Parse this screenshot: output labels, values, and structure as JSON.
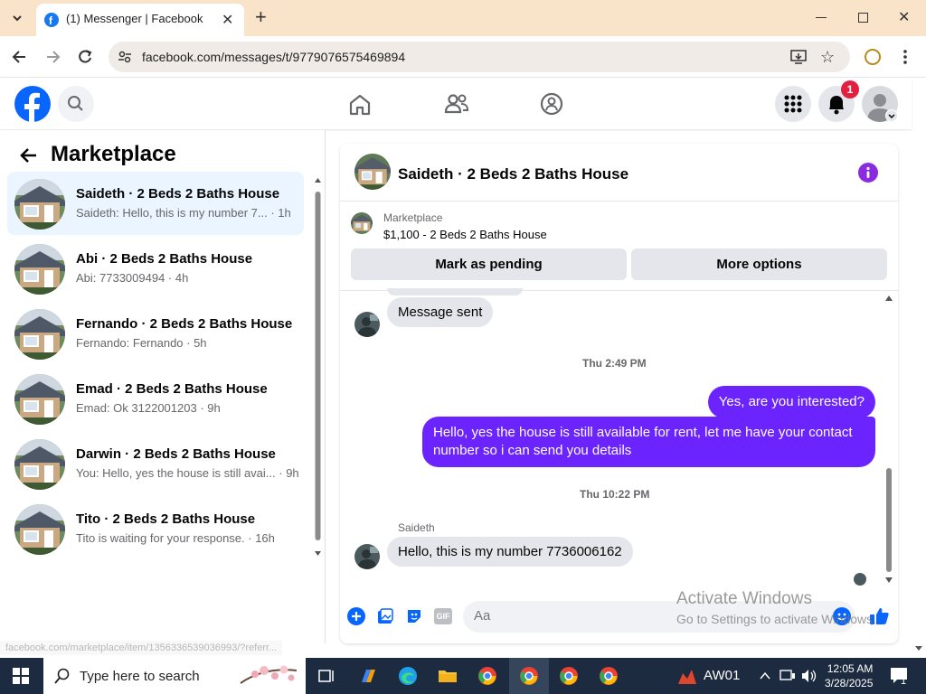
{
  "browser": {
    "tab_title": "(1) Messenger | Facebook",
    "url": "facebook.com/messages/t/9779076575469894",
    "status_url": "facebook.com/marketplace/item/1356336539036993/?referr..."
  },
  "header": {
    "notification_count": "1"
  },
  "left_panel": {
    "title": "Marketplace",
    "conversations": [
      {
        "name": "Saideth · 2 Beds 2 Baths House",
        "preview": "Saideth: Hello, this is my number 7... · 1h",
        "active": true
      },
      {
        "name": "Abi · 2 Beds 2 Baths House",
        "preview": "Abi: 7733009494 · 4h",
        "active": false
      },
      {
        "name": "Fernando · 2 Beds 2 Baths House",
        "preview": "Fernando: Fernando · 5h",
        "active": false
      },
      {
        "name": "Emad · 2 Beds 2 Baths House",
        "preview": "Emad: Ok 3122001203 · 9h",
        "active": false
      },
      {
        "name": "Darwin · 2 Beds 2 Baths House",
        "preview": "You: Hello, yes the house is still avai... · 9h",
        "active": false
      },
      {
        "name": "Tito · 2 Beds 2 Baths House",
        "preview": "Tito is waiting for your response. · 16h",
        "active": false
      }
    ]
  },
  "chat": {
    "title": "Saideth · 2 Beds 2 Baths House",
    "marketplace_label": "Marketplace",
    "listing": "$1,100 - 2 Beds 2 Baths House",
    "mark_pending_label": "Mark as pending",
    "more_options_label": "More options",
    "messages": {
      "msg_sent": "Message sent",
      "ts1": "Thu 2:49 PM",
      "out1": "Yes, are you interested?",
      "out2": "Hello, yes the house is still available for rent, let me have your contact number so i can send you  details",
      "ts2": "Thu 10:22 PM",
      "sender": "Saideth",
      "in1": "Hello, this is my number 7736006162"
    },
    "composer_placeholder": "Aa",
    "accent": "#6c24ff"
  },
  "watermark": {
    "line1": "Activate Windows",
    "line2": "Go to Settings to activate Windows."
  },
  "taskbar": {
    "search_placeholder": "Type here to search",
    "weather_label": "AW01",
    "time": "12:05 AM",
    "date": "3/28/2025",
    "notif_count": "1"
  }
}
